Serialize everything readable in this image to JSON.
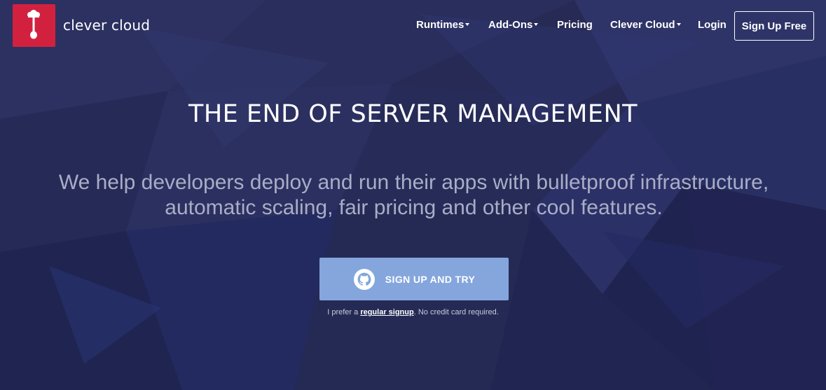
{
  "brand": {
    "name": "clever cloud",
    "logo_icon": "clever-cloud-logo-icon",
    "logo_color": "#d2213f"
  },
  "nav": {
    "items": [
      {
        "label": "Runtimes",
        "dropdown": true
      },
      {
        "label": "Add-Ons",
        "dropdown": true
      },
      {
        "label": "Pricing",
        "dropdown": false
      },
      {
        "label": "Clever Cloud",
        "dropdown": true
      },
      {
        "label": "Login",
        "dropdown": false
      }
    ],
    "signup_label": "Sign Up Free"
  },
  "hero": {
    "title": "THE END OF SERVER MANAGEMENT",
    "subtitle": "We help developers deploy and run their apps with bulletproof infrastructure, automatic scaling, fair pricing and other cool features.",
    "cta_label": "SIGN UP AND TRY",
    "cta_icon": "github-icon",
    "cta_color": "#84a6dd",
    "note_prefix": "I prefer a",
    "note_link": "regular signup",
    "note_suffix": ". No credit card required."
  },
  "colors": {
    "background": "#272a55",
    "subtitle_text": "#a9adc6"
  }
}
